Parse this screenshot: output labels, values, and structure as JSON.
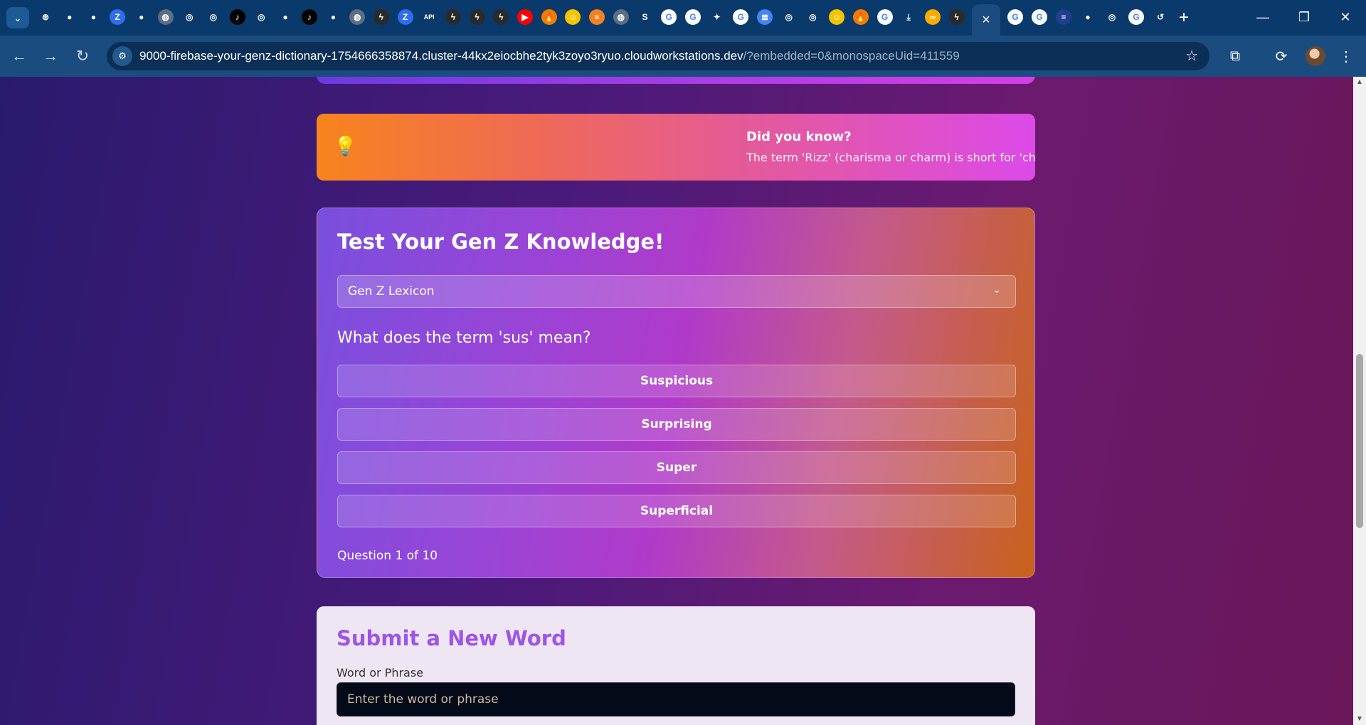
{
  "browser": {
    "url_host": "9000-firebase-your-genz-dictionary-1754666358874.cluster-44kx2eiocbhe2tyk3zoyo3ryuo.cloudworkstations.dev",
    "url_rest": "/?embedded=0&monospaceUid=411559",
    "tab_icons": [
      "chatgpt-icon",
      "github-icon",
      "github-icon",
      "z-icon",
      "github-icon",
      "globe-icon",
      "chrome-icon",
      "chrome-icon",
      "tiktok-icon",
      "chrome-icon",
      "github-icon",
      "tiktok-icon",
      "github-icon",
      "globe-icon",
      "bolt-icon",
      "z-icon",
      "api-icon",
      "bolt-icon",
      "bolt-icon",
      "bolt-icon",
      "youtube-icon",
      "fire-icon",
      "emoji-icon",
      "stack-icon",
      "globe-icon",
      "s-icon",
      "google-icon",
      "google-icon",
      "gemini-icon",
      "google-icon",
      "docs-icon",
      "chrome-icon",
      "chrome-icon",
      "emoji-icon",
      "fire-icon",
      "google-icon",
      "download-icon",
      "colab-icon",
      "bolt-icon"
    ],
    "tab_icons_after": [
      "google-icon",
      "google-icon",
      "ibm-icon",
      "github-icon",
      "chrome-icon",
      "google-icon",
      "history-icon"
    ],
    "api_label": "API",
    "z_label": "Z",
    "s_label": "S"
  },
  "page": {
    "did_you_know": {
      "title": "Did you know?",
      "fact": "The term 'Rizz' (charisma or charm) is short for 'charisma'."
    },
    "quiz": {
      "title": "Test Your Gen Z Knowledge!",
      "category": "Gen Z Lexicon",
      "question": "What does the term 'sus' mean?",
      "options": [
        "Suspicious",
        "Surprising",
        "Super",
        "Superficial"
      ],
      "progress": "Question 1 of 10"
    },
    "submit": {
      "title": "Submit a New Word",
      "label": "Word or Phrase",
      "placeholder": "Enter the word or phrase"
    }
  }
}
